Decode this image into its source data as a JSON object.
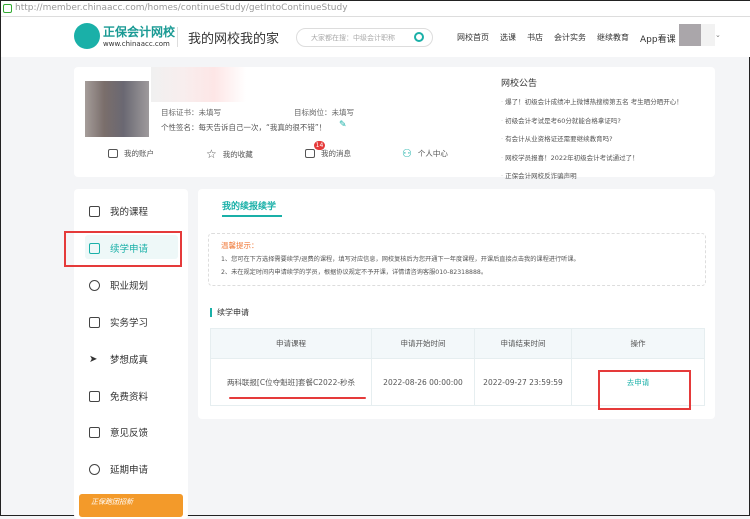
{
  "browser": {
    "url": "http://member.chinaacc.com/homes/continueStudy/getIntoContinueStudy"
  },
  "header": {
    "logo_brand": "正保会计网校",
    "logo_domain": "www.chinaacc.com",
    "site_title": "我的网校我的家",
    "search_placeholder": "大家都在搜：中级会计职称",
    "nav": [
      "网校首页",
      "选课",
      "书店",
      "会计实务",
      "继续教育",
      "App看课"
    ]
  },
  "profile": {
    "target_cert_label": "目标证书：",
    "target_cert_value": "未填写",
    "target_job_label": "目标岗位：",
    "target_job_value": "未填写",
    "signature_label": "个性签名：",
    "signature_value": "每天告诉自己一次，“我真的很不错”！",
    "quick_links": [
      {
        "label": "我的账户",
        "icon": "wallet-icon"
      },
      {
        "label": "我的收藏",
        "icon": "star-icon"
      },
      {
        "label": "我的消息",
        "icon": "mail-icon",
        "badge": "14"
      },
      {
        "label": "个人中心",
        "icon": "user-icon"
      }
    ]
  },
  "notice": {
    "title": "网校公告",
    "items": [
      "爆了！初级会计成绩冲上微博热搜榜第五名 考生晒分晒开心！",
      "初级会计考试是考60分就能合格拿证吗?",
      "有会计从业资格证还需要继续教育吗?",
      "网校学员报喜！2022年初级会计考试通过了！",
      "正保会计网校反诈骗声明"
    ]
  },
  "sidebar": {
    "items": [
      "我的课程",
      "续学申请",
      "职业规划",
      "实务学习",
      "梦想成真",
      "免费资料",
      "意见反馈",
      "延期申请"
    ],
    "active": "续学申请",
    "banner_text": "正保跑团招新"
  },
  "main": {
    "tab": "我的续报续学",
    "tips_title": "温馨提示：",
    "tips": [
      "1、您可在下方选择需要续学/退费的课程，填写对应信息，网校复核后为您开通下一年度课程，开课后直接点击我的课程进行听课。",
      "2、未在规定时间内申请续学的学员，根据协议规定不予开课，详情请咨询客服010-82318888。"
    ],
    "section_title": "续学申请",
    "table": {
      "headers": [
        "申请课程",
        "申请开始时间",
        "申请结束时间",
        "操作"
      ],
      "rows": [
        {
          "course": "两科联报[C位夺魁班]套餐C2022-秒杀",
          "start": "2022-08-26 00:00:00",
          "end": "2022-09-27 23:59:59",
          "action": "去申请"
        }
      ]
    }
  },
  "colors": {
    "accent": "#1ab0a8",
    "highlight": "#e53a3a",
    "tips": "#f07a3a",
    "badge": "#e53a3a"
  }
}
